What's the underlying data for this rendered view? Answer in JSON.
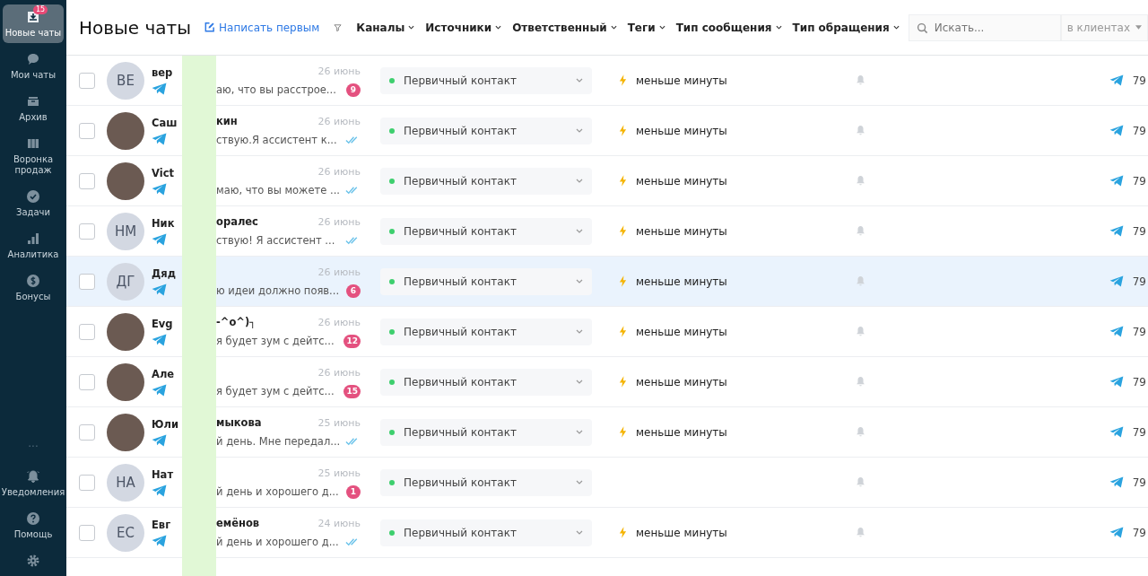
{
  "sidebar": {
    "items": [
      {
        "kind": "inbox",
        "label": "Новые чаты",
        "selected": true,
        "badge": "15"
      },
      {
        "kind": "chat",
        "label": "Мои чаты",
        "selected": false
      },
      {
        "kind": "archive",
        "label": "Архив",
        "selected": false
      },
      {
        "kind": "funnel",
        "label": "Воронка продаж",
        "selected": false
      },
      {
        "kind": "tasks",
        "label": "Задачи",
        "selected": false
      },
      {
        "kind": "analytics",
        "label": "Аналитика",
        "selected": false
      },
      {
        "kind": "bonus",
        "label": "Бонусы",
        "selected": false
      }
    ],
    "more": "···",
    "bottom_items": [
      {
        "kind": "bell",
        "label": "Уведомления"
      },
      {
        "kind": "help",
        "label": "Помощь"
      },
      {
        "kind": "gear"
      }
    ]
  },
  "header": {
    "title": "Новые чаты",
    "write_first": "Написать первым",
    "filters": [
      "Каналы",
      "Источники",
      "Ответственный",
      "Теги",
      "Тип сообщения",
      "Тип обращения"
    ],
    "search": {
      "placeholder": "Искать...",
      "scope": "в клиентах"
    }
  },
  "chats": [
    {
      "avatar": {
        "kind": "initials",
        "text": "ВЕ"
      },
      "name_start": "вер",
      "date": "26 июнь",
      "preview": "аю, что вы расстрое...",
      "unread": "9",
      "selected": false,
      "status": {
        "label": "Первичный контакт",
        "color": "#3ecf6e"
      },
      "response": "меньше минуты",
      "channel_number": "79"
    },
    {
      "avatar": {
        "kind": "photo"
      },
      "name_start": "Саш",
      "name_end": "кин",
      "date": "26 июнь",
      "preview": "ствую.Я ассистент к...",
      "selected": false,
      "status": {
        "label": "Первичный контакт",
        "color": "#3ecf6e"
      },
      "response": "меньше минуты",
      "channel_number": "79"
    },
    {
      "avatar": {
        "kind": "photo"
      },
      "name_start": "Vict",
      "date": "26 июнь",
      "preview": "маю, что вы можете ...",
      "selected": false,
      "status": {
        "label": "Первичный контакт",
        "color": "#3ecf6e"
      },
      "response": "меньше минуты",
      "channel_number": "79"
    },
    {
      "avatar": {
        "kind": "initials",
        "text": "НМ"
      },
      "name_start": "Ник",
      "name_end": "оралес",
      "date": "26 июнь",
      "preview": "ствую! Я ассистент ...",
      "selected": false,
      "status": {
        "label": "Первичный контакт",
        "color": "#3ecf6e"
      },
      "response": "меньше минуты",
      "channel_number": "79"
    },
    {
      "avatar": {
        "kind": "initials",
        "text": "ДГ"
      },
      "name_start": "Дяд",
      "date": "26 июнь",
      "preview": "ю идеи должно появ...",
      "unread": "6",
      "selected": true,
      "status": {
        "label": "Первичный контакт",
        "color": "#3ecf6e"
      },
      "response": "меньше минуты",
      "channel_number": "79"
    },
    {
      "avatar": {
        "kind": "photo"
      },
      "name_start": "Evg",
      "name_end": "-^o^)┐",
      "date": "26 июнь",
      "preview": "я будет зум с дейтс...",
      "unread": "12",
      "selected": false,
      "status": {
        "label": "Первичный контакт",
        "color": "#3ecf6e"
      },
      "response": "меньше минуты",
      "channel_number": "79"
    },
    {
      "avatar": {
        "kind": "photo"
      },
      "name_start": "Але",
      "date": "26 июнь",
      "preview": "я будет зум с дейтс...",
      "unread": "15",
      "selected": false,
      "status": {
        "label": "Первичный контакт",
        "color": "#3ecf6e"
      },
      "response": "меньше минуты",
      "channel_number": "79"
    },
    {
      "avatar": {
        "kind": "photo"
      },
      "name_start": "Юли",
      "name_end": "мыкова",
      "date": "25 июнь",
      "preview": "й день. Мне передал...",
      "selected": false,
      "status": {
        "label": "Первичный контакт",
        "color": "#3ecf6e"
      },
      "response": "меньше минуты",
      "channel_number": "79"
    },
    {
      "avatar": {
        "kind": "initials",
        "text": "НА"
      },
      "name_start": "Нат",
      "date": "25 июнь",
      "preview": "й день и хорошего д...",
      "unread": "1",
      "selected": false,
      "status": {
        "label": "Первичный контакт",
        "color": "#3ecf6e"
      },
      "channel_number": "79"
    },
    {
      "avatar": {
        "kind": "initials",
        "text": "ЕС"
      },
      "name_start": "Евг",
      "name_end": "емёнов",
      "date": "24 июнь",
      "preview": "й день и хорошего д...",
      "selected": false,
      "status": {
        "label": "Первичный контакт",
        "color": "#3ecf6e"
      },
      "response": "меньше минуты",
      "channel_number": "79"
    }
  ]
}
